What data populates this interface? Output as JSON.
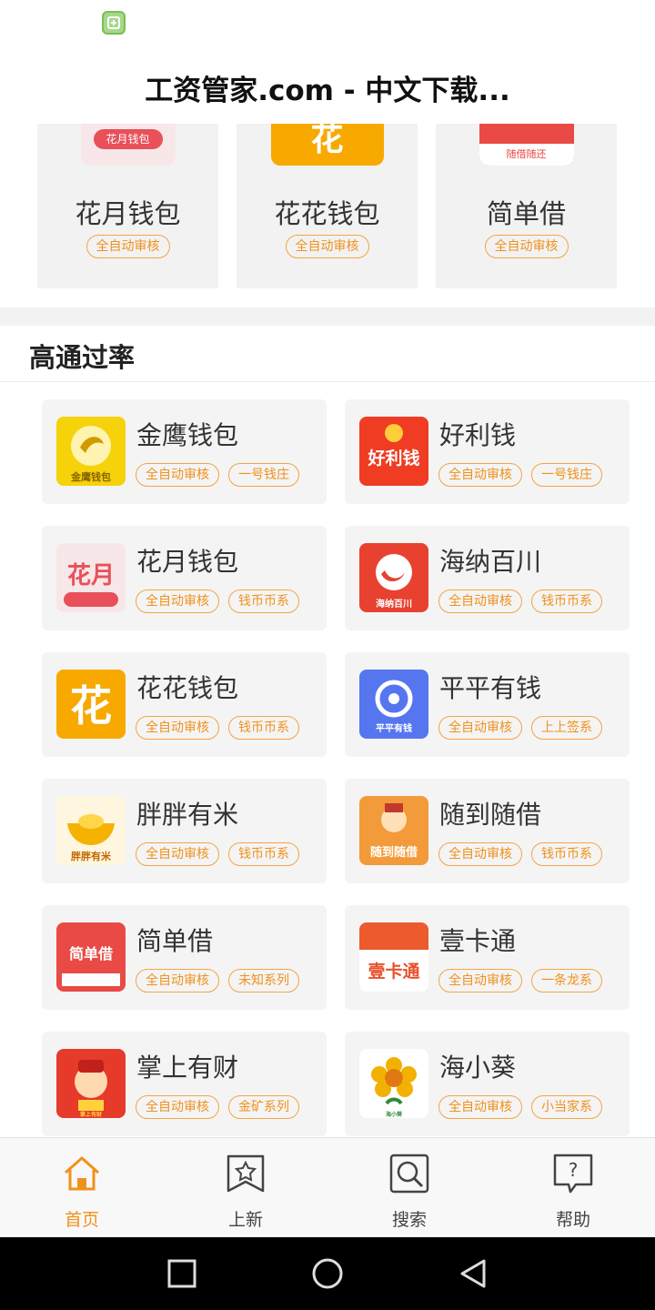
{
  "page": {
    "title": "工资管家.com - 中文下载..."
  },
  "status_bar": {
    "app_icon": "app-icon"
  },
  "top_cards": [
    {
      "name": "花月钱包",
      "tag": "全自动审核",
      "thumb_color": "#e8505a",
      "thumb_text": "花月钱包"
    },
    {
      "name": "花花钱包",
      "tag": "全自动审核",
      "thumb_color": "#f7a900",
      "thumb_text": "花"
    },
    {
      "name": "简单借",
      "tag": "全自动审核",
      "thumb_color": "#e94a45",
      "thumb_text": "随借随还"
    }
  ],
  "section": {
    "title": "高通过率"
  },
  "apps": [
    {
      "name": "金鹰钱包",
      "tags": [
        "全自动审核",
        "一号钱庄"
      ],
      "logo_bg": "#f6d20a",
      "logo_text": "金鹰钱包",
      "logo_color": "#b07d00"
    },
    {
      "name": "好利钱",
      "tags": [
        "全自动审核",
        "一号钱庄"
      ],
      "logo_bg": "#ef3c22",
      "logo_text": "好利钱",
      "logo_color": "#ffffff"
    },
    {
      "name": "花月钱包",
      "tags": [
        "全自动审核",
        "钱币币系"
      ],
      "logo_bg": "#f7e7e8",
      "logo_text": "花月",
      "logo_color": "#e8505a"
    },
    {
      "name": "海纳百川",
      "tags": [
        "全自动审核",
        "钱币币系"
      ],
      "logo_bg": "#e8412f",
      "logo_text": "海纳百川",
      "logo_color": "#ffffff"
    },
    {
      "name": "花花钱包",
      "tags": [
        "全自动审核",
        "钱币币系"
      ],
      "logo_bg": "#f7a900",
      "logo_text": "花",
      "logo_color": "#ffffff"
    },
    {
      "name": "平平有钱",
      "tags": [
        "全自动审核",
        "上上签系"
      ],
      "logo_bg": "#5676f0",
      "logo_text": "平平有钱",
      "logo_color": "#ffffff"
    },
    {
      "name": "胖胖有米",
      "tags": [
        "全自动审核",
        "钱币币系"
      ],
      "logo_bg": "#fff6e0",
      "logo_text": "胖胖有米",
      "logo_color": "#d0720a"
    },
    {
      "name": "随到随借",
      "tags": [
        "全自动审核",
        "钱币币系"
      ],
      "logo_bg": "#f39a3a",
      "logo_text": "随到随借",
      "logo_color": "#ffffff"
    },
    {
      "name": "简单借",
      "tags": [
        "全自动审核",
        "未知系列"
      ],
      "logo_bg": "#e94a45",
      "logo_text": "简单借",
      "logo_color": "#ffffff"
    },
    {
      "name": "壹卡通",
      "tags": [
        "全自动审核",
        "一条龙系"
      ],
      "logo_bg": "#ffffff",
      "logo_text": "壹卡通",
      "logo_color": "#e9502c"
    },
    {
      "name": "掌上有财",
      "tags": [
        "全自动审核",
        "金矿系列"
      ],
      "logo_bg": "#e63a2a",
      "logo_text": "掌上有财",
      "logo_color": "#ffd23c"
    },
    {
      "name": "海小葵",
      "tags": [
        "全自动审核",
        "小当家系"
      ],
      "logo_bg": "#ffffff",
      "logo_text": "海小葵",
      "logo_color": "#f2a000"
    }
  ],
  "tabs": [
    {
      "label": "首页",
      "icon": "home-icon",
      "active": true
    },
    {
      "label": "上新",
      "icon": "star-icon",
      "active": false
    },
    {
      "label": "搜索",
      "icon": "search-icon",
      "active": false
    },
    {
      "label": "帮助",
      "icon": "help-icon",
      "active": false
    }
  ],
  "nav": [
    "recent-apps-icon",
    "home-circle-icon",
    "back-icon"
  ],
  "colors": {
    "accent": "#f0911c",
    "card_bg": "#f4f4f4"
  }
}
